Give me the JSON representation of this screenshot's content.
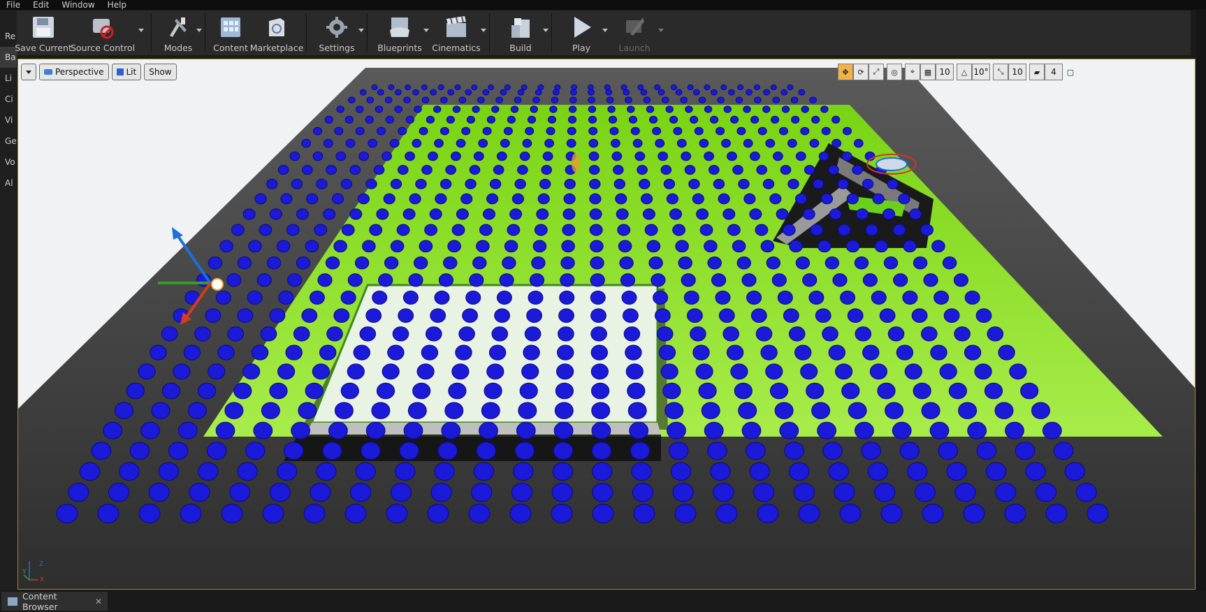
{
  "menu": [
    "File",
    "Edit",
    "Window",
    "Help"
  ],
  "toolbar": {
    "save_current": "Save Current",
    "source_control": "Source Control",
    "modes": "Modes",
    "content": "Content",
    "marketplace": "Marketplace",
    "settings": "Settings",
    "blueprints": "Blueprints",
    "cinematics": "Cinematics",
    "build": "Build",
    "play": "Play",
    "launch": "Launch"
  },
  "left_tabs": [
    "Re",
    "Ba",
    "Li",
    "Ci",
    "Vi",
    "Ge",
    "Vo",
    "Al"
  ],
  "viewport": {
    "perspective": "Perspective",
    "lit": "Lit",
    "show": "Show",
    "grid_snap": "10",
    "rotation_snap": "10°",
    "scale_snap": "10",
    "camera_speed": "4"
  },
  "axis_labels": {
    "z": "Z",
    "y": "Y",
    "x": "X"
  },
  "bottom": {
    "content_browser": "Content Browser"
  },
  "icons": {
    "save": "save-icon",
    "source_control": "source-control-icon",
    "modes": "modes-icon",
    "content": "content-icon",
    "marketplace": "marketplace-icon",
    "settings": "gear-icon",
    "blueprints": "blueprints-icon",
    "cinematics": "clapper-icon",
    "build": "build-icon",
    "play": "play-icon",
    "launch": "launch-icon"
  },
  "colors": {
    "accent": "#f1b24a",
    "floor_green": "#8fe02a",
    "cube_blue": "#1a1ad8",
    "selection": "#b8860b"
  }
}
